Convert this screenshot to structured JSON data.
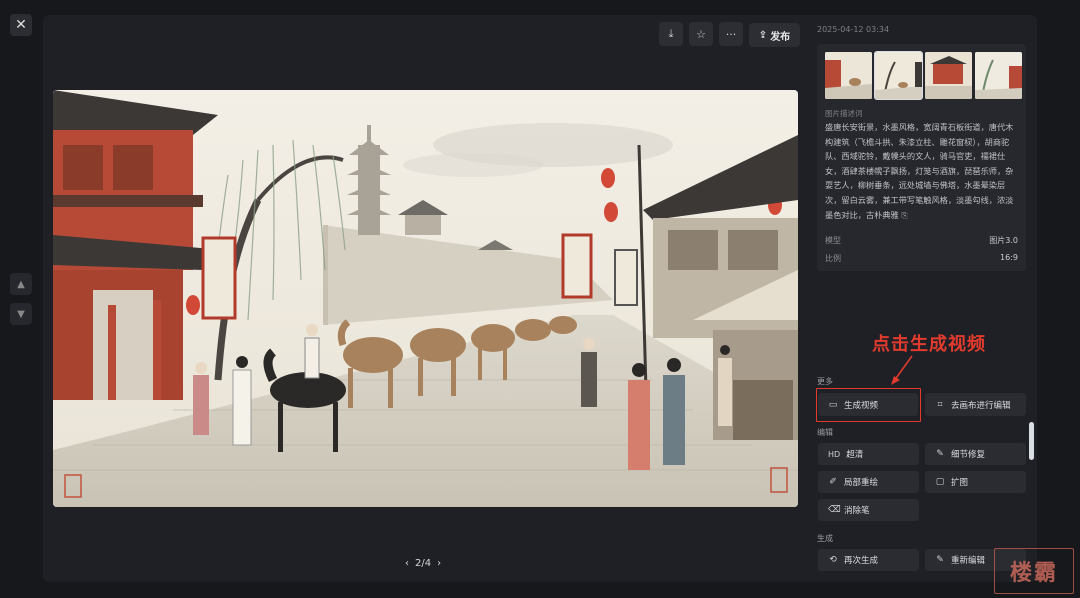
{
  "toolbar": {
    "publish_label": "发布"
  },
  "pager": {
    "text": "2/4"
  },
  "side": {
    "timestamp": "2025-04-12 03:34",
    "description_label": "图片描述词",
    "description": "盛唐长安街景，水墨风格，宽阔青石板街道，唐代木构建筑（飞檐斗拱、朱漆立柱、雕花窗棂），胡商驼队、西域驼铃，戴幞头的文人，骑马官吏，襦裙仕女，酒肆茶楼幌子飘扬，灯笼与酒旗，琵琶乐师，杂耍艺人，柳树垂条，远处城墙与佛塔，水墨晕染层次，留白云雾，兼工带写笔触风格，淡墨勾线，浓淡墨色对比，古朴典雅",
    "meta": [
      {
        "key": "模型",
        "value": "图片3.0"
      },
      {
        "key": "比例",
        "value": "16:9"
      }
    ]
  },
  "callout": "点击生成视频",
  "sections": {
    "more": "更多",
    "edit": "编辑",
    "generate": "生成"
  },
  "actions": {
    "generate_video": "生成视频",
    "canvas_edit": "去画布进行编辑",
    "hd": "超清",
    "detail_fix": "细节修复",
    "partial_redraw": "局部重绘",
    "expand": "扩图",
    "eraser": "消除笔",
    "regenerate": "再次生成",
    "reedit": "重新编辑"
  },
  "icons": {
    "hd_badge": "HD"
  },
  "watermark": "楼霸"
}
